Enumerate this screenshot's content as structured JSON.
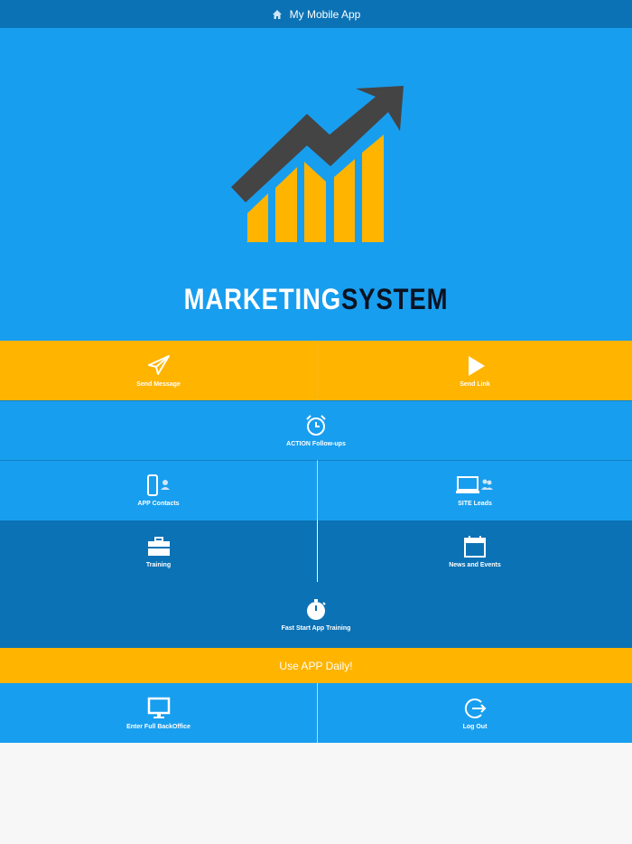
{
  "header": {
    "title": "My Mobile App",
    "icon": "home-icon"
  },
  "logo": {
    "word1": "MARKETING",
    "word2": "SYSTEM"
  },
  "tiles": {
    "send_message": {
      "label": "Send Message",
      "icon": "paper-plane-icon"
    },
    "send_link": {
      "label": "Send Link",
      "icon": "play-icon"
    },
    "action_followups": {
      "label": "ACTION Follow-ups",
      "icon": "alarm-clock-icon"
    },
    "app_contacts": {
      "label": "APP Contacts",
      "icon": "phone-contact-icon"
    },
    "site_leads": {
      "label": "SITE Leads",
      "icon": "laptop-users-icon"
    },
    "training": {
      "label": "Training",
      "icon": "briefcase-icon"
    },
    "news_events": {
      "label": "News and Events",
      "icon": "calendar-icon"
    },
    "fast_start": {
      "label": "Fast Start App Training",
      "icon": "stopwatch-icon"
    },
    "backoffice": {
      "label": "Enter Full BackOffice",
      "icon": "monitor-icon"
    },
    "logout": {
      "label": "Log Out",
      "icon": "logout-icon"
    }
  },
  "banner": {
    "label": "Use APP Daily!"
  },
  "colors": {
    "blue": "#189eef",
    "dark_blue": "#0b72b5",
    "orange": "#ffb400",
    "arrow": "#444444"
  }
}
